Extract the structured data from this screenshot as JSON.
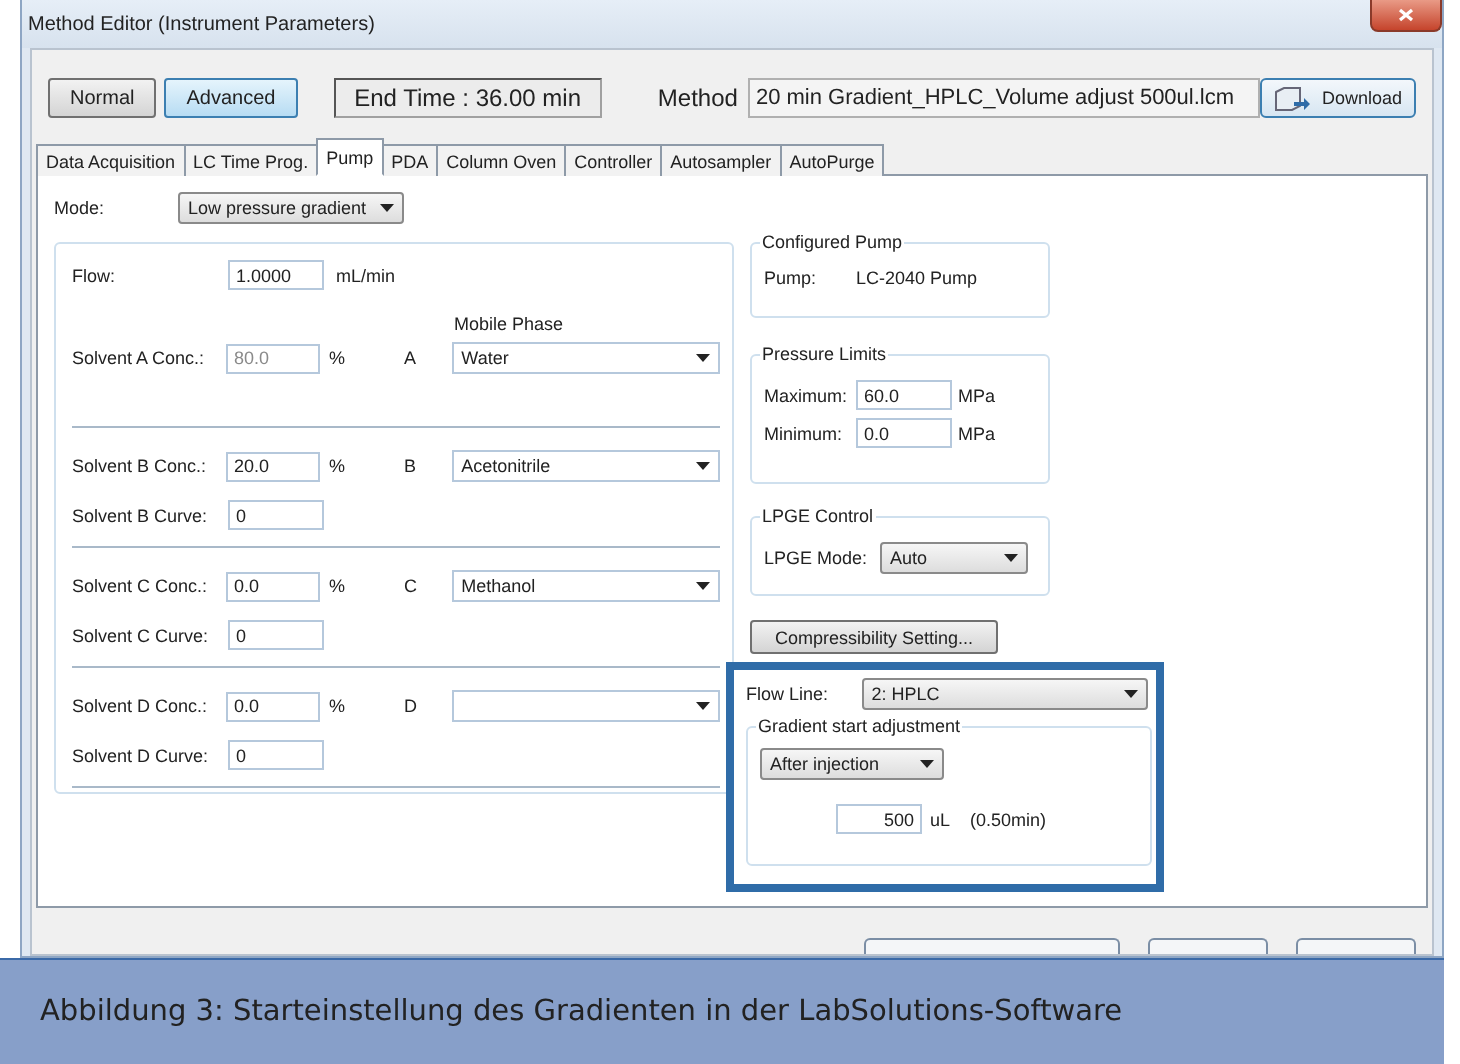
{
  "window": {
    "title": "Method Editor (Instrument Parameters)"
  },
  "view_modes": [
    {
      "label": "Normal",
      "selected": false
    },
    {
      "label": "Advanced",
      "selected": true
    }
  ],
  "end_time": "End Time : 36.00 min",
  "method": {
    "label": "Method",
    "value": "20 min Gradient_HPLC_Volume adjust 500ul.lcm"
  },
  "download_button": "Download",
  "tabs": [
    {
      "label": "Data Acquisition",
      "selected": false
    },
    {
      "label": "LC Time Prog.",
      "selected": false
    },
    {
      "label": "Pump",
      "selected": true
    },
    {
      "label": "PDA",
      "selected": false
    },
    {
      "label": "Column Oven",
      "selected": false
    },
    {
      "label": "Controller",
      "selected": false
    },
    {
      "label": "Autosampler",
      "selected": false
    },
    {
      "label": "AutoPurge",
      "selected": false
    }
  ],
  "mode": {
    "label": "Mode:",
    "value": "Low pressure gradient"
  },
  "flow": {
    "label": "Flow:",
    "value": "1.0000",
    "unit": "mL/min"
  },
  "mobile_phase_heading": "Mobile Phase",
  "solvents": [
    {
      "conc_label": "Solvent A Conc.:",
      "conc_value": "80.0",
      "disabled": true,
      "unit": "%",
      "letter": "A",
      "phase": "Water"
    },
    {
      "conc_label": "Solvent B Conc.:",
      "conc_value": "20.0",
      "disabled": false,
      "unit": "%",
      "letter": "B",
      "phase": "Acetonitrile",
      "curve_label": "Solvent B Curve:",
      "curve_value": "0"
    },
    {
      "conc_label": "Solvent C Conc.:",
      "conc_value": "0.0",
      "disabled": false,
      "unit": "%",
      "letter": "C",
      "phase": "Methanol",
      "curve_label": "Solvent C Curve:",
      "curve_value": "0"
    },
    {
      "conc_label": "Solvent D Conc.:",
      "conc_value": "0.0",
      "disabled": false,
      "unit": "%",
      "letter": "D",
      "curve_label": "Solvent D Curve:",
      "curve_value": "0"
    }
  ],
  "configured_pump": {
    "title": "Configured Pump",
    "label": "Pump:",
    "value": "LC-2040 Pump"
  },
  "pressure_limits": {
    "title": "Pressure Limits",
    "rows": [
      {
        "label": "Maximum:",
        "value": "60.0",
        "unit": "MPa"
      },
      {
        "label": "Minimum:",
        "value": "0.0",
        "unit": "MPa"
      }
    ]
  },
  "lpge_control": {
    "title": "LPGE Control",
    "label": "LPGE Mode:",
    "value": "Auto"
  },
  "compressibility_button": "Compressibility Setting...",
  "flow_line": {
    "label": "Flow Line:",
    "value": "2: HPLC"
  },
  "gradient_start": {
    "title": "Gradient start adjustment",
    "timing": "After injection",
    "volume": "500",
    "unit": "uL",
    "time": "(0.50min)"
  },
  "caption": "Abbildung 3: Starteinstellung des Gradienten in der LabSolutions-Software"
}
